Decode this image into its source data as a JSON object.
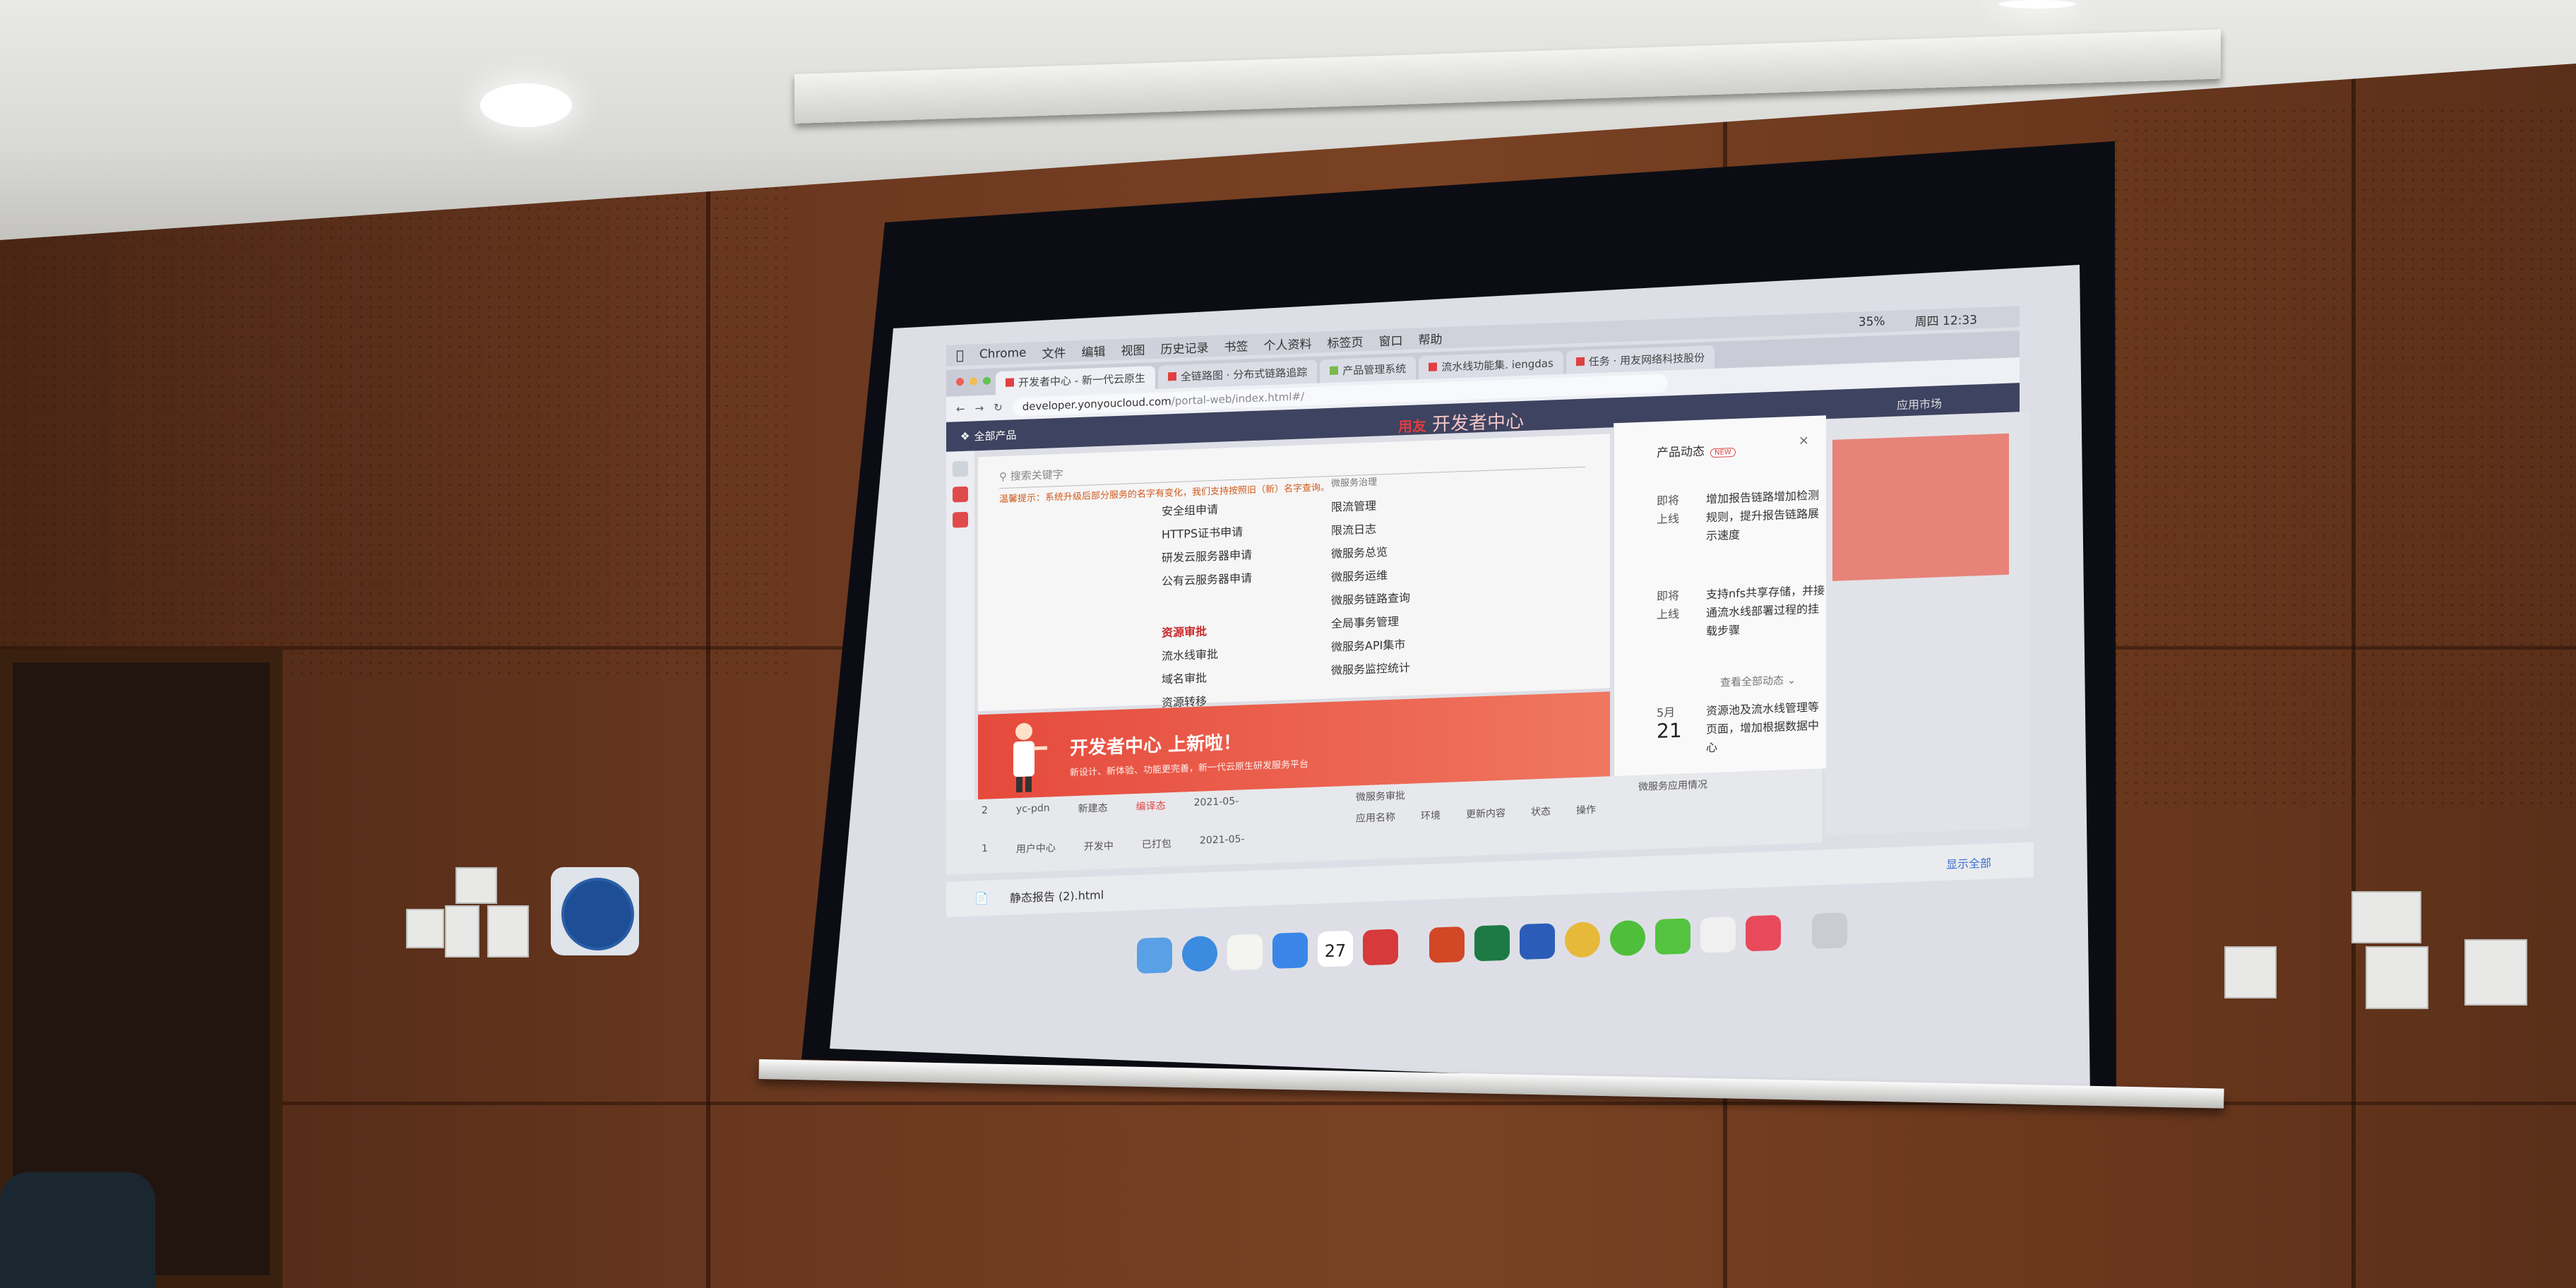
{
  "menubar": {
    "app": "Chrome",
    "items": [
      "文件",
      "编辑",
      "视图",
      "历史记录",
      "书签",
      "个人资料",
      "标签页",
      "窗口",
      "帮助"
    ],
    "battery": "35%",
    "clock": "周四 12:33"
  },
  "tabs": [
    {
      "label": "开发者中心 - 新一代云原生"
    },
    {
      "label": "全链路图 · 分布式链路追踪"
    },
    {
      "label": "产品管理系统"
    },
    {
      "label": "流水线功能集. iengdas"
    },
    {
      "label": "任务 · 用友网络科技股份"
    }
  ],
  "url": {
    "host": "developer.yonyoucloud.com",
    "path": "/portal-web/index.html#/"
  },
  "header": {
    "all_products": "全部产品",
    "brand_logo": "用友",
    "brand_title": "开发者中心",
    "right_link": "应用市场"
  },
  "dropdown": {
    "search_placeholder": "搜索关键字",
    "notice": "温馨提示：系统升级后部分服务的名字有变化，我们支持按照旧（新）名字查询。",
    "left_col": {
      "items_top": [
        "安全组申请",
        "HTTPS证书申请",
        "研发云服务器申请",
        "公有云服务器申请"
      ],
      "section": "资源审批",
      "items_bottom": [
        "流水线审批",
        "域名审批",
        "资源转移"
      ]
    },
    "right_col": {
      "section_top": "微服务治理",
      "items": [
        "限流管理",
        "限流日志",
        "微服务总览",
        "微服务运维",
        "微服务链路查询",
        "全局事务管理",
        "微服务API集市",
        "微服务监控统计"
      ]
    }
  },
  "banner": {
    "title": "开发者中心 上新啦！",
    "subtitle": "新设计、新体验、功能更完善，新一代云原生研发服务平台"
  },
  "panel": {
    "title": "产品动态",
    "badge": "NEW",
    "items": [
      {
        "when": "即将上线",
        "text": "增加报告链路增加检测规则，提升报告链路展示速度"
      },
      {
        "when": "即将上线",
        "text": "支持nfs共享存储，并接通流水线部署过程的挂载步骤"
      },
      {
        "when_month": "5月",
        "when_day": "21",
        "text": "资源池及流水线管理等页面，增加根据数据中心"
      }
    ],
    "more": "查看全部动态"
  },
  "table": {
    "rows": [
      {
        "no": "2",
        "name": "yc-pdn",
        "type": "新建态",
        "status": "编译态",
        "date": "2021-05-"
      },
      {
        "no": "1",
        "name": "用户中心",
        "type": "开发中",
        "status": "已打包",
        "date": "2021-05-"
      }
    ],
    "headers": [
      "应用名称",
      "环境",
      "更新内容",
      "状态",
      "操作"
    ],
    "section_left": "微服务审批",
    "section_right": "微服务应用情况"
  },
  "downloads": {
    "file": "静态报告 (2).html",
    "show_all": "显示全部"
  },
  "colors": {
    "accent_red": "#e23c3c",
    "header_bg": "#3d4360",
    "banner": "#e64a3c",
    "notice": "#d05a1a"
  },
  "dock_icons": [
    "finder-icon",
    "safari-icon",
    "notes-icon",
    "appstore-icon",
    "calendar-icon",
    "yonyou-icon",
    "powerpoint-icon",
    "excel-icon",
    "word-icon",
    "chrome-icon",
    "wechat-icon",
    "messages-icon",
    "qq-icon",
    "app-icon",
    "trash-icon"
  ],
  "dock_calendar_day": "27"
}
